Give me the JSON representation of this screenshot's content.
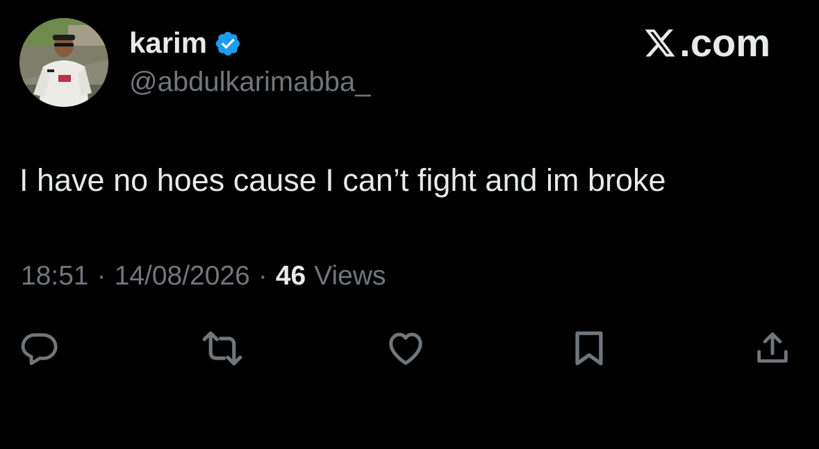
{
  "author": {
    "display_name": "karim",
    "handle": "@abdulkarimabba_",
    "verified": true,
    "avatar_icon": "avatar-photo"
  },
  "brand": {
    "icon": "x-logo-icon",
    "text": ".com"
  },
  "tweet": {
    "text": "I have no hoes cause I can’t fight and im broke"
  },
  "meta": {
    "time": "18:51",
    "separator": "·",
    "date": "14/08/2026",
    "views_count": "46",
    "views_label": "Views"
  },
  "actions": [
    {
      "icon": "reply-icon"
    },
    {
      "icon": "retweet-icon"
    },
    {
      "icon": "like-icon"
    },
    {
      "icon": "bookmark-icon"
    },
    {
      "icon": "share-icon"
    }
  ],
  "colors": {
    "background": "#000000",
    "primary_text": "#e7e9ea",
    "secondary_text": "#71767b",
    "verified_blue": "#1d9bf0"
  }
}
